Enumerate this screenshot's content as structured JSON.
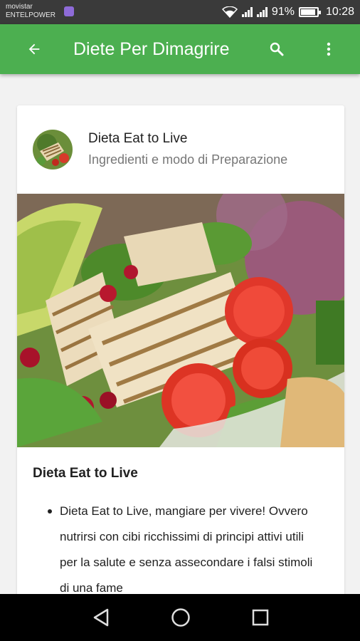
{
  "status_bar": {
    "carrier_line1": "movistar",
    "carrier_line2": "ENTELPOWER",
    "battery_text": "91%",
    "battery_level": 0.91,
    "time": "10:28"
  },
  "app_bar": {
    "title": "Diete Per Dimagrire",
    "color": "#4caf50",
    "back_icon": "arrow-back-icon",
    "search_icon": "search-icon",
    "more_icon": "more-vert-icon"
  },
  "card": {
    "title": "Dieta Eat to Live",
    "subtitle": "Ingredienti e modo di Preparazione",
    "section_title": "Dieta Eat to Live",
    "bullet_text": "Dieta Eat to Live, mangiare per vivere! Ovvero nutrirsi con cibi ricchissimi di principi attivi utili per la salute e senza assecondare i falsi stimoli di una fame"
  },
  "nav_bar": {
    "back_icon": "nav-back-icon",
    "home_icon": "nav-home-icon",
    "recents_icon": "nav-recents-icon"
  }
}
